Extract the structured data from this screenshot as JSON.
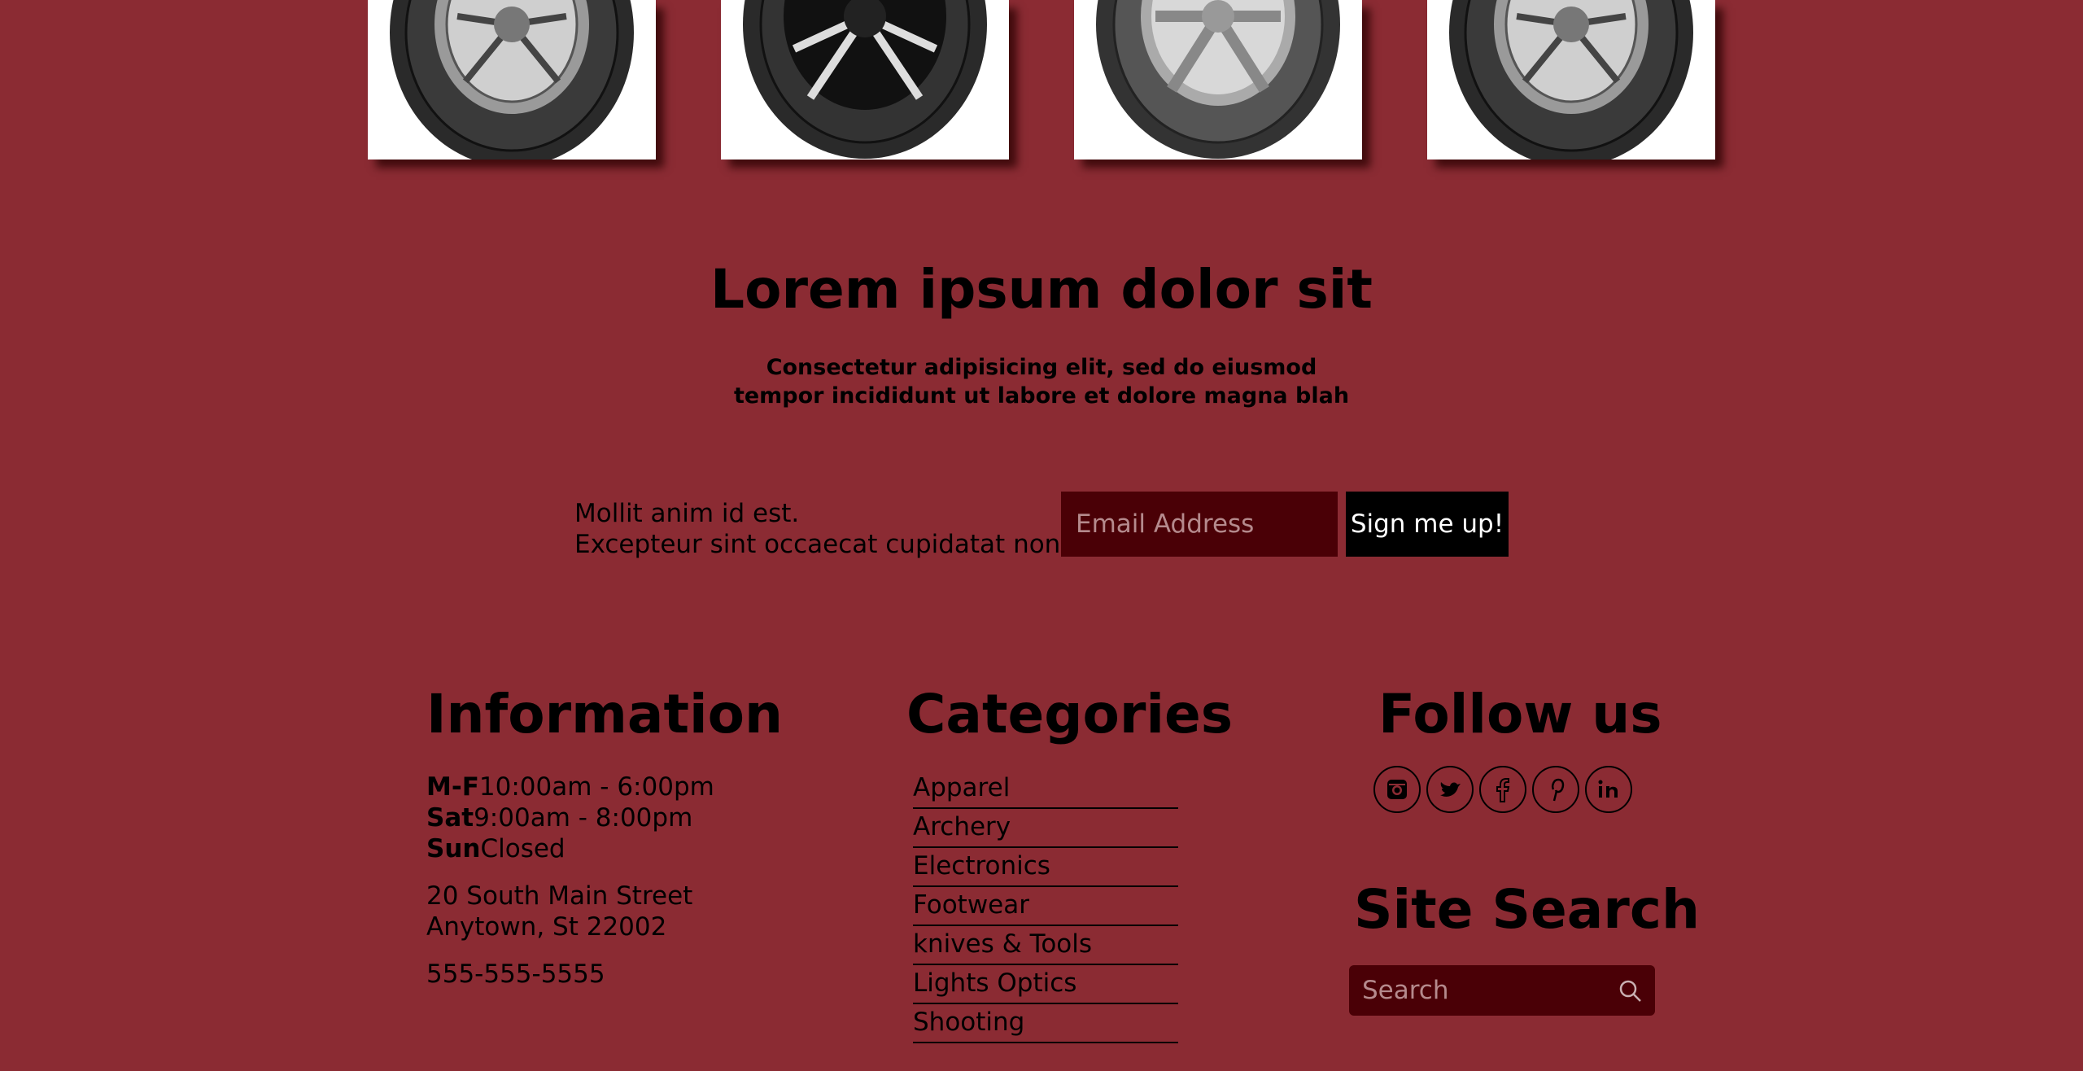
{
  "products": [
    {
      "name": "tire-1"
    },
    {
      "name": "tire-2"
    },
    {
      "name": "tire-3"
    },
    {
      "name": "tire-4"
    }
  ],
  "hero": {
    "title": "Lorem ipsum dolor sit",
    "subtitle_line1": "Consectetur adipisicing elit, sed do eiusmod",
    "subtitle_line2": "tempor incididunt ut labore et dolore magna blah"
  },
  "signup": {
    "text_line1": "Mollit anim id est.",
    "text_line2": "Excepteur sint occaecat cupidatat non",
    "email_placeholder": "Email Address",
    "button_label": "Sign me up!"
  },
  "information": {
    "title": "Information",
    "hours": [
      {
        "day": "M-F",
        "time": "10:00am - 6:00pm"
      },
      {
        "day": "Sat",
        "time": "9:00am - 8:00pm"
      },
      {
        "day": "Sun",
        "time": "Closed"
      }
    ],
    "address_line1": "20 South Main Street",
    "address_line2": "Anytown, St 22002",
    "phone": "555-555-5555"
  },
  "categories": {
    "title": "Categories",
    "items": [
      "Apparel",
      "Archery",
      "Electronics",
      "Footwear",
      "knives & Tools",
      "Lights Optics",
      "Shooting"
    ]
  },
  "follow": {
    "title": "Follow us",
    "icons": [
      "instagram-icon",
      "twitter-icon",
      "facebook-icon",
      "pinterest-icon",
      "linkedin-icon"
    ]
  },
  "site_search": {
    "title": "Site Search",
    "placeholder": "Search"
  },
  "colors": {
    "background": "#8b2b33",
    "input_background": "#4a0006",
    "button_background": "#000000"
  }
}
